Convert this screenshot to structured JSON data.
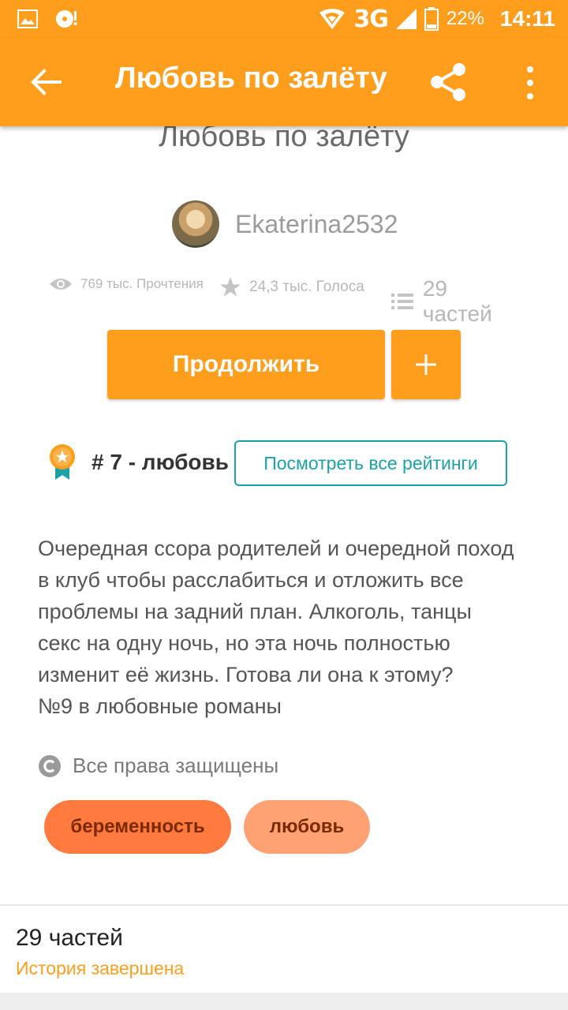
{
  "status_bar": {
    "network": "3G",
    "battery_percent": "22%",
    "time": "14:11"
  },
  "toolbar": {
    "title": "Любовь по залёту",
    "icons": [
      "back-arrow-icon",
      "share-icon",
      "more-vert-icon"
    ]
  },
  "story": {
    "title": "Любовь по залёту",
    "author": "Ekaterina2532",
    "stats": {
      "reads": "769 тыс. Прочтения",
      "votes": "24,3 тыс. Голоса",
      "parts": "29 частей"
    },
    "continue_label": "Продолжить",
    "add_label": "+",
    "rank": "# 7 - любовь",
    "ratings_button": "Посмотреть все рейтинги",
    "description": "Очередная ссора родителей и очередной поход\nв клуб чтобы расслабиться и отложить все\nпроблемы на задний план. Алкоголь, танцы\nсекс на одну ночь, но эта ночь полностью\nизменит её жизнь. Готова ли она к этому?\n№9 в любовные романы",
    "rights": "Все права защищены",
    "tags": [
      "беременность",
      "любовь"
    ]
  },
  "parts_section": {
    "count": "29 частей",
    "status": "История завершена"
  },
  "colors": {
    "accent": "#ff9d1c",
    "teal": "#1aa2a8",
    "tag_primary": "#ff7a3c",
    "tag_secondary": "#ffa273"
  }
}
